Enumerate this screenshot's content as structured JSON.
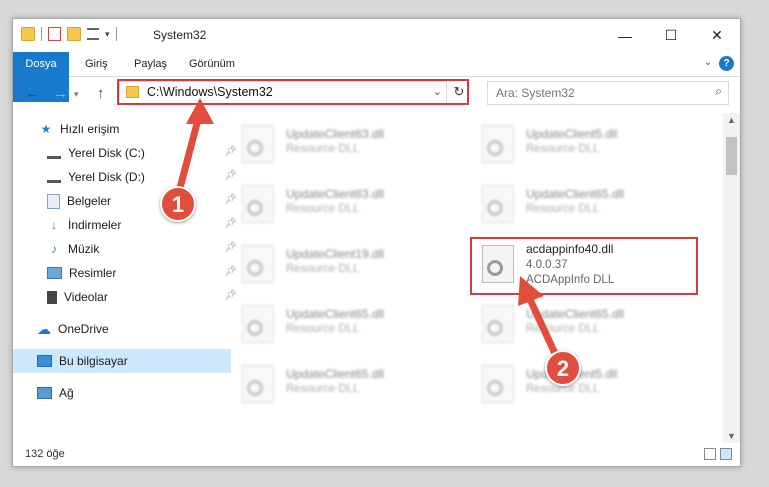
{
  "window": {
    "title": "System32"
  },
  "ribbon": {
    "tabs": [
      "Dosya",
      "Giriş",
      "Paylaş",
      "Görünüm"
    ],
    "help": "?"
  },
  "navbar": {
    "address": "C:\\Windows\\System32",
    "search_placeholder": "Ara: System32"
  },
  "sidebar": {
    "items": [
      {
        "label": "Hızlı erişim",
        "icon": "star-icon",
        "pinned": false
      },
      {
        "label": "Yerel Disk (C:)",
        "icon": "drive-icon",
        "pinned": true
      },
      {
        "label": "Yerel Disk (D:)",
        "icon": "drive-icon",
        "pinned": true
      },
      {
        "label": "Belgeler",
        "icon": "documents-icon",
        "pinned": true
      },
      {
        "label": "İndirmeler",
        "icon": "download-icon",
        "pinned": true
      },
      {
        "label": "Müzik",
        "icon": "music-icon",
        "pinned": true
      },
      {
        "label": "Resimler",
        "icon": "pictures-icon",
        "pinned": true
      },
      {
        "label": "Videolar",
        "icon": "videos-icon",
        "pinned": true
      },
      {
        "label": "OneDrive",
        "icon": "cloud-icon",
        "pinned": false
      },
      {
        "label": "Bu bilgisayar",
        "icon": "computer-icon",
        "pinned": false
      },
      {
        "label": "Ağ",
        "icon": "network-icon",
        "pinned": false
      }
    ]
  },
  "files": [
    {
      "name": "UpdateClient63.dll",
      "desc": "Resource DLL"
    },
    {
      "name": "UpdateClient5.dll",
      "desc": "Resource DLL"
    },
    {
      "name": "UpdateClient63.dll",
      "desc": "Resource DLL"
    },
    {
      "name": "UpdateClient65.dll",
      "desc": "Resource DLL"
    },
    {
      "name": "UpdateClient19.dll",
      "desc": "Resource DLL"
    },
    {
      "name": "acdappinfo40.dll",
      "version": "4.0.0.37",
      "desc": "ACDAppInfo DLL"
    },
    {
      "name": "UpdateClient65.dll",
      "desc": "Resource DLL"
    },
    {
      "name": "UpdateClient65.dll",
      "desc": "Resource DLL"
    },
    {
      "name": "UpdateClient65.dll",
      "desc": "Resource DLL"
    },
    {
      "name": "UpdateClient5.dll",
      "desc": "Resource DLL"
    }
  ],
  "status": {
    "count": "132 öğe"
  },
  "callouts": [
    "1",
    "2"
  ],
  "colors": {
    "accent": "#1979ca",
    "highlight": "#d23c3c",
    "callout": "#e14e3d",
    "selected": "#cce8ff"
  }
}
